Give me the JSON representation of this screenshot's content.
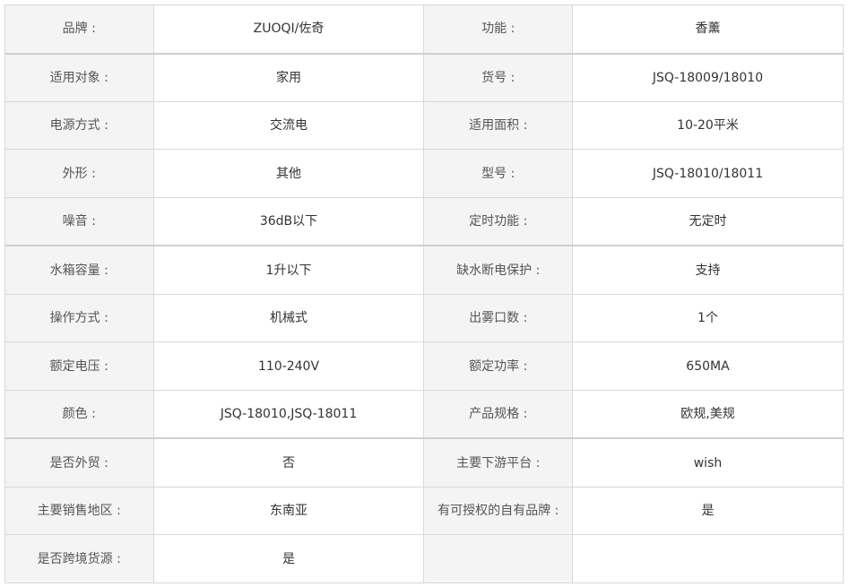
{
  "rows": [
    {
      "label1": "品牌 :",
      "value1": "ZUOQI/佐奇",
      "label2": "功能 :",
      "value2": "香薰"
    },
    {
      "label1": "适用对象 :",
      "value1": "家用",
      "label2": "货号 :",
      "value2": "JSQ-18009/18010"
    },
    {
      "label1": "电源方式 :",
      "value1": "交流电",
      "label2": "适用面积 :",
      "value2": "10-20平米"
    },
    {
      "label1": "外形 :",
      "value1": "其他",
      "label2": "型号 :",
      "value2": "JSQ-18010/18011"
    },
    {
      "label1": "噪音 :",
      "value1": "36dB以下",
      "label2": "定时功能 :",
      "value2": "无定时"
    },
    {
      "label1": "水箱容量 :",
      "value1": "1升以下",
      "label2": "缺水断电保护 :",
      "value2": "支持"
    },
    {
      "label1": "操作方式 :",
      "value1": "机械式",
      "label2": "出雾口数 :",
      "value2": "1个"
    },
    {
      "label1": "额定电压 :",
      "value1": "110-240V",
      "label2": "额定功率 :",
      "value2": "650MA"
    },
    {
      "label1": "颜色 :",
      "value1": "JSQ-18010,JSQ-18011",
      "label2": "产品规格 :",
      "value2": "欧规,美规"
    },
    {
      "label1": "是否外贸 :",
      "value1": "否",
      "label2": "主要下游平台 :",
      "value2": "wish"
    },
    {
      "label1": "主要销售地区 :",
      "value1": "东南亚",
      "label2": "有可授权的自有品牌 :",
      "value2": "是"
    },
    {
      "label1": "是否跨境货源 :",
      "value1": "是",
      "label2": "",
      "value2": ""
    }
  ]
}
